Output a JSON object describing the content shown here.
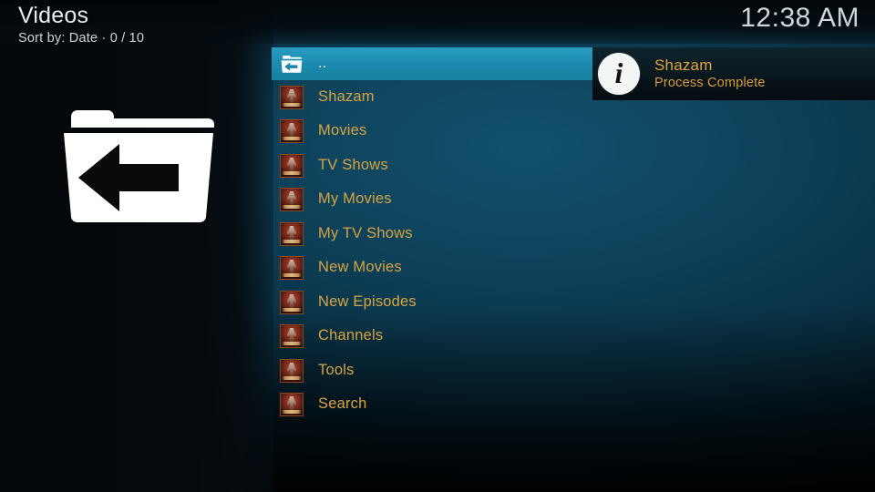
{
  "header": {
    "title": "Videos",
    "subtitle": "Sort by: Date  ·  0 / 10",
    "clock": "12:38 AM"
  },
  "icons": {
    "parent_folder_big": "folder-back-icon",
    "parent_folder_small": "folder-back-icon",
    "notification": "info-icon"
  },
  "list": {
    "parent_item": {
      "label": "..",
      "selected": true
    },
    "items": [
      {
        "label": "Shazam"
      },
      {
        "label": "Movies"
      },
      {
        "label": "TV Shows"
      },
      {
        "label": "My Movies"
      },
      {
        "label": "My TV Shows"
      },
      {
        "label": "New Movies"
      },
      {
        "label": "New Episodes"
      },
      {
        "label": "Channels"
      },
      {
        "label": "Tools"
      },
      {
        "label": "Search"
      }
    ]
  },
  "notification": {
    "title": "Shazam",
    "message": "Process Complete"
  },
  "colors": {
    "accent_highlight": "#1c8bb1",
    "item_text": "#d9a441",
    "notification_text": "#e0a33e",
    "background": "#0d3e56"
  }
}
